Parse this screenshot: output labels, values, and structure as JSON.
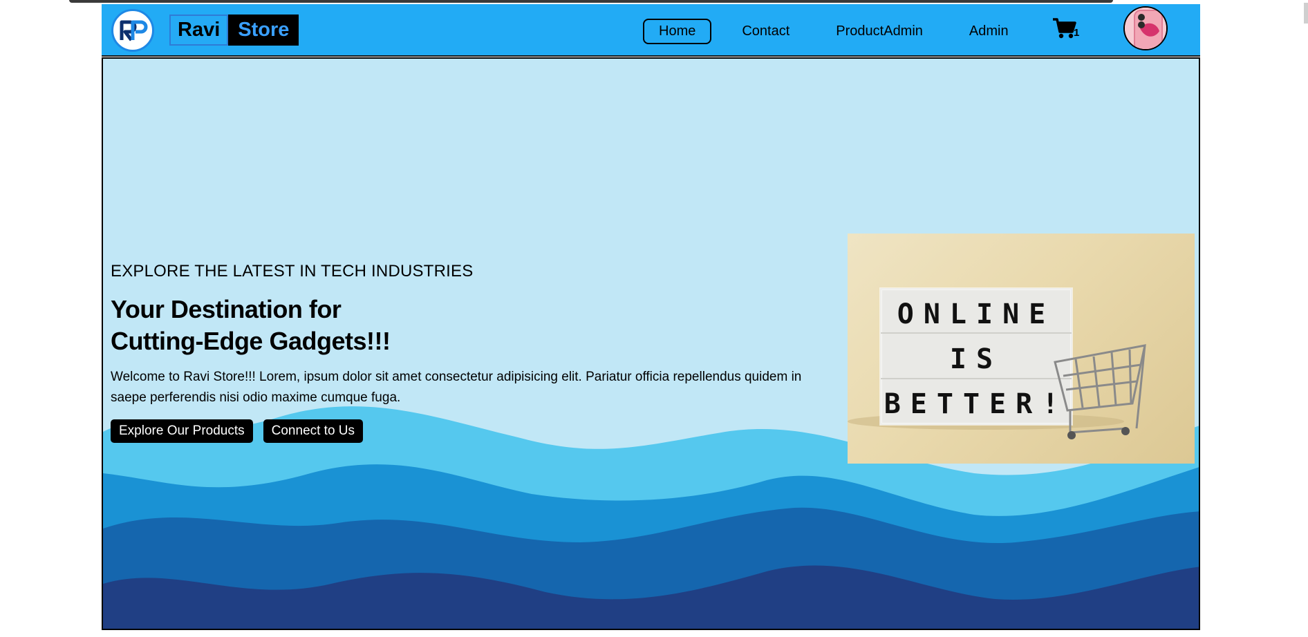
{
  "brand": {
    "name_first": "Ravi",
    "name_second": "Store",
    "logo_text": "RP"
  },
  "nav": {
    "items": [
      {
        "label": "Home",
        "active": true
      },
      {
        "label": "Contact",
        "active": false
      },
      {
        "label": "ProductAdmin",
        "active": false
      },
      {
        "label": "Admin",
        "active": false
      }
    ],
    "cart_count": "1"
  },
  "hero": {
    "eyebrow": "EXPLORE THE LATEST IN TECH INDUSTRIES",
    "headline_line1": "Your Destination for",
    "headline_line2": "Cutting-Edge Gadgets!!!",
    "description": "Welcome to Ravi Store!!! Lorem, ipsum dolor sit amet consectetur adipisicing elit. Pariatur officia repellendus quidem in saepe perferendis nisi odio maxime cumque fuga.",
    "cta_primary": "Explore Our Products",
    "cta_secondary": "Connect to Us",
    "image_sign": {
      "line1": "ONLINE",
      "line2": "IS",
      "line3": "BETTER!"
    }
  },
  "colors": {
    "navbar": "#22abf5",
    "hero_bg": "#c1e7f6",
    "wave_1": "#55c8ee",
    "wave_2": "#1a92d4",
    "wave_3": "#1566ae",
    "wave_4": "#203f84",
    "brand_store_text": "#3aa0ff"
  }
}
